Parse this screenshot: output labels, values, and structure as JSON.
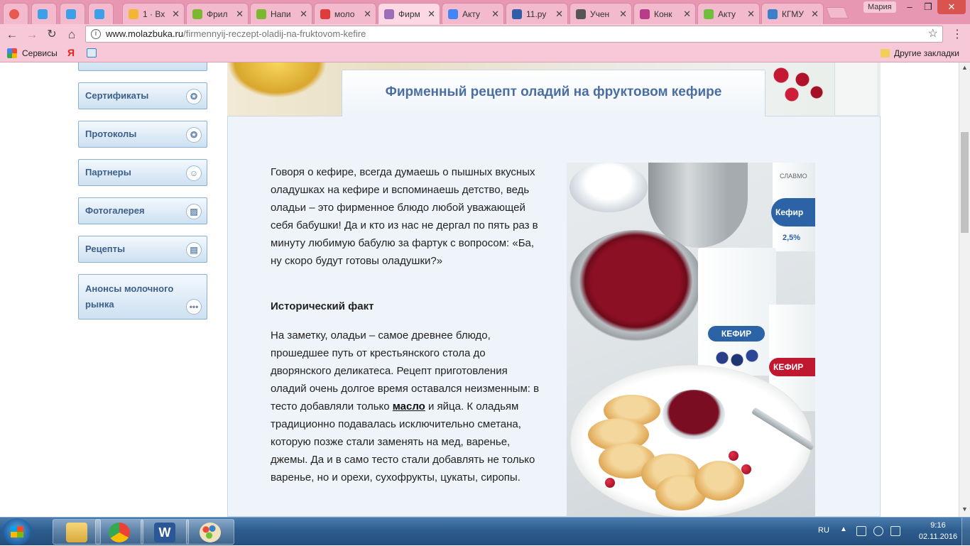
{
  "browser": {
    "tabs": [
      {
        "label": "",
        "color": "#e85a4f"
      },
      {
        "label": "",
        "color": "#3aa0e8"
      },
      {
        "label": "",
        "color": "#3aa0e8"
      },
      {
        "label": "",
        "color": "#3aa0e8"
      },
      {
        "label": "1 · Вх",
        "color": "#f2b632"
      },
      {
        "label": "Фрил",
        "color": "#7cb82f"
      },
      {
        "label": "Напи",
        "color": "#7cb82f"
      },
      {
        "label": "моло",
        "color": "#e03c3c"
      },
      {
        "label": "Фирм",
        "color": "#9a6fb8"
      },
      {
        "label": "Акту",
        "color": "#4285f4"
      },
      {
        "label": "11.ру",
        "color": "#2f5fa8"
      },
      {
        "label": "Учен",
        "color": "#555555"
      },
      {
        "label": "Конк",
        "color": "#b83c8a"
      },
      {
        "label": "Акту",
        "color": "#6fbf3a"
      },
      {
        "label": "КГМУ",
        "color": "#3a7fc8"
      }
    ],
    "user": "Мария",
    "url_domain": "www.molazbuka.ru",
    "url_path": "/firmennyij-reczept-oladij-na-fruktovom-kefire",
    "bookmarks": {
      "services": "Сервисы",
      "yandex": "Я",
      "other": "Другие закладки"
    }
  },
  "sidebar": {
    "items": [
      {
        "label": "Сертификаты",
        "icon": "ribbon-icon"
      },
      {
        "label": "Протоколы",
        "icon": "ribbon-icon"
      },
      {
        "label": "Партнеры",
        "icon": "person-icon"
      },
      {
        "label": "Фотогалерея",
        "icon": "image-icon"
      },
      {
        "label": "Рецепты",
        "icon": "document-icon"
      },
      {
        "label": "Анонсы молочного рынка",
        "icon": "more-icon"
      }
    ]
  },
  "article": {
    "title": "Фирменный рецепт оладий на фруктовом кефире",
    "intro": "Говоря о кефире, всегда думаешь о пышных вкусных оладушках на кефире и вспоминаешь детство, ведь оладьи – это фирменное блюдо любой уважающей себя бабушки! Да и кто из нас не дергал по пять раз в минуту любимую бабулю за фартук с вопросом: «Ба, ну скоро будут готовы оладушки?»",
    "subheading": "Исторический факт",
    "fact_before": "На заметку, оладьи – самое древнее блюдо, прошедшее путь от крестьянского стола до дворянского деликатеса. Рецепт приготовления оладий очень долгое время оставался неизменным: в тесто добавляли только ",
    "fact_link": "масло",
    "fact_after": " и яйца. К оладьям традиционно подавалась исключительно сметана, которую позже стали заменять на мед, варенье, джемы. Да и в само тесто стали добавлять не только варенье, но и орехи, сухофрукты, цукаты, сиропы.",
    "photo": {
      "kefir_label": "КЕФИР",
      "kefir_label_2": "Кефир",
      "brand": "СЛАВМО",
      "fat": "2,5%"
    }
  },
  "taskbar": {
    "lang": "RU",
    "time": "9:16",
    "date": "02.11.2016"
  }
}
